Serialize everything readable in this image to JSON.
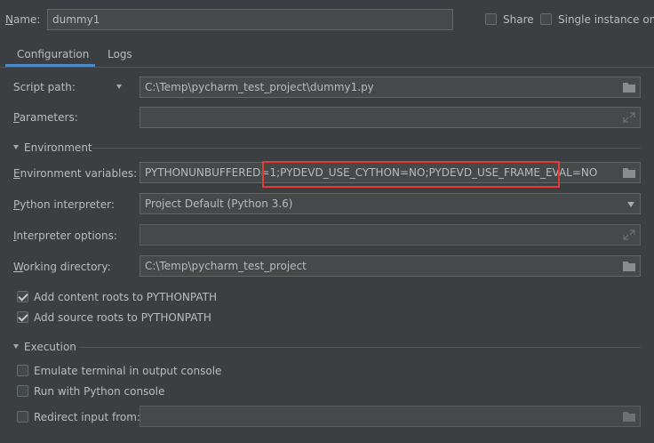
{
  "header": {
    "name_label": "Name:",
    "name_value": "dummy1",
    "share_label": "Share",
    "single_instance_label": "Single instance only"
  },
  "tabs": [
    {
      "label": "Configuration",
      "active": true
    },
    {
      "label": "Logs",
      "active": false
    }
  ],
  "config": {
    "script_path_label": "Script path:",
    "script_path_value": "C:\\Temp\\pycharm_test_project\\dummy1.py",
    "parameters_label": "Parameters:",
    "parameters_value": "",
    "environment_section": "Environment",
    "env_vars_label": "Environment variables:",
    "env_vars_value": "PYTHONUNBUFFERED=1;PYDEVD_USE_CYTHON=NO;PYDEVD_USE_FRAME_EVAL=NO",
    "interpreter_label": "Python interpreter:",
    "interpreter_value": "Project Default (Python 3.6)",
    "interpreter_options_label": "Interpreter options:",
    "interpreter_options_value": "",
    "working_dir_label": "Working directory:",
    "working_dir_value": "C:\\Temp\\pycharm_test_project",
    "add_content_roots_label": "Add content roots to PYTHONPATH",
    "add_content_roots_checked": true,
    "add_source_roots_label": "Add source roots to PYTHONPATH",
    "add_source_roots_checked": true,
    "execution_section": "Execution",
    "emulate_terminal_label": "Emulate terminal in output console",
    "emulate_terminal_checked": false,
    "run_python_console_label": "Run with Python console",
    "run_python_console_checked": false,
    "redirect_input_label": "Redirect input from:",
    "redirect_input_checked": false,
    "redirect_input_value": ""
  },
  "colors": {
    "background": "#3c3f41",
    "field_bg": "#45494a",
    "tab_underline": "#4a88c7",
    "highlight": "#e53935"
  }
}
